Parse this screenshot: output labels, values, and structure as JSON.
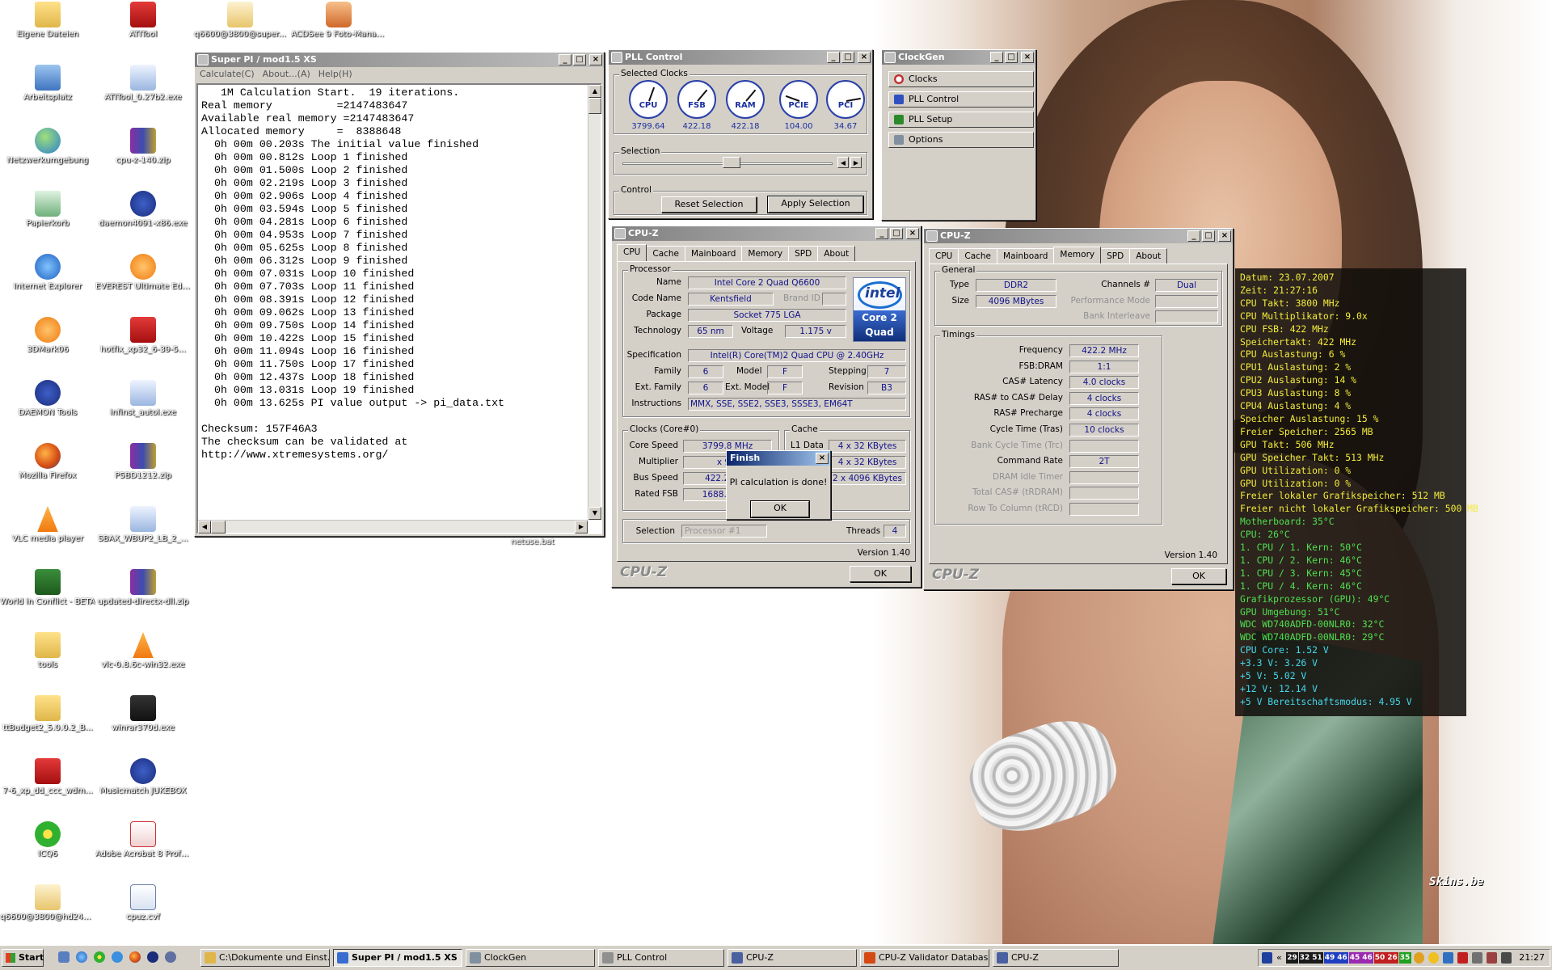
{
  "desktop": {
    "watermark": "Skins.be",
    "icons": [
      {
        "label": "Eigene Dateien",
        "icon": "folder-icon"
      },
      {
        "label": "ATITool",
        "icon": "atitool-icon"
      },
      {
        "label": "q6600@3800@super...",
        "icon": "jpg-file-icon"
      },
      {
        "label": "ACDSee 9 Foto-Manager",
        "icon": "acdsee-icon"
      },
      {
        "label": "Arbeitsplatz",
        "icon": "computer-icon"
      },
      {
        "label": "ATITool_0.27b2.exe",
        "icon": "installer-icon"
      },
      {
        "label": "Netzwerkumgebung",
        "icon": "network-icon"
      },
      {
        "label": "cpu-z-140.zip",
        "icon": "rar-archive-icon"
      },
      {
        "label": "Papierkorb",
        "icon": "recycle-bin-icon"
      },
      {
        "label": "daemon4091-x86.exe",
        "icon": "daemon-tools-icon"
      },
      {
        "label": "Internet Explorer",
        "icon": "internet-explorer-icon"
      },
      {
        "label": "EVEREST Ultimate Edition",
        "icon": "everest-icon"
      },
      {
        "label": "3DMark06",
        "icon": "3dmark-icon"
      },
      {
        "label": "hotfix_xp32_6-39-5...",
        "icon": "ati-icon"
      },
      {
        "label": "DAEMON Tools",
        "icon": "daemon-tools-icon"
      },
      {
        "label": "infinst_autol.exe",
        "icon": "intel-installer-icon"
      },
      {
        "label": "Mozilla Firefox",
        "icon": "firefox-icon"
      },
      {
        "label": "P5BD1212.zip",
        "icon": "rar-archive-icon"
      },
      {
        "label": "VLC media player",
        "icon": "vlc-icon"
      },
      {
        "label": "SBAX_WBUP2_LB_2_...",
        "icon": "installer-icon"
      },
      {
        "label": "World in Conflict - BETA",
        "icon": "game-icon"
      },
      {
        "label": "updated-directx-dll.zip",
        "icon": "rar-archive-icon"
      },
      {
        "label": "tools",
        "icon": "folder-icon"
      },
      {
        "label": "vlc-0.8.6c-win32.exe",
        "icon": "vlc-icon"
      },
      {
        "label": "ttBudget2_5.0.0.2_B...",
        "icon": "folder-icon"
      },
      {
        "label": "winrar370d.exe",
        "icon": "winrar-icon"
      },
      {
        "label": "7-6_xp_dd_ccc_wdm...",
        "icon": "ati-icon"
      },
      {
        "label": "Musicmatch JUKEBOX",
        "icon": "musicmatch-icon"
      },
      {
        "label": "ICQ6",
        "icon": "icq-icon"
      },
      {
        "label": "Adobe Acrobat 8 Professional",
        "icon": "acrobat-icon"
      },
      {
        "label": "q6600@3800@hd2400...",
        "icon": "jpg-file-icon"
      },
      {
        "label": "cpuz.cvf",
        "icon": "config-file-icon"
      },
      {
        "label": "netuse.bat",
        "icon": "batch-file-icon"
      }
    ]
  },
  "superpi": {
    "title": "Super PI / mod1.5 XS",
    "menu": [
      "Calculate(C)",
      "About...(A)",
      "Help(H)"
    ],
    "lines": [
      "   1M Calculation Start.  19 iterations.",
      "Real memory          =2147483647",
      "Available real memory =2147483647",
      "Allocated memory     =  8388648",
      "  0h 00m 00.203s The initial value finished",
      "  0h 00m 00.812s Loop 1 finished",
      "  0h 00m 01.500s Loop 2 finished",
      "  0h 00m 02.219s Loop 3 finished",
      "  0h 00m 02.906s Loop 4 finished",
      "  0h 00m 03.594s Loop 5 finished",
      "  0h 00m 04.281s Loop 6 finished",
      "  0h 00m 04.953s Loop 7 finished",
      "  0h 00m 05.625s Loop 8 finished",
      "  0h 00m 06.312s Loop 9 finished",
      "  0h 00m 07.031s Loop 10 finished",
      "  0h 00m 07.703s Loop 11 finished",
      "  0h 00m 08.391s Loop 12 finished",
      "  0h 00m 09.062s Loop 13 finished",
      "  0h 00m 09.750s Loop 14 finished",
      "  0h 00m 10.422s Loop 15 finished",
      "  0h 00m 11.094s Loop 16 finished",
      "  0h 00m 11.750s Loop 17 finished",
      "  0h 00m 12.437s Loop 18 finished",
      "  0h 00m 13.031s Loop 19 finished",
      "  0h 00m 13.625s PI value output -> pi_data.txt",
      "",
      "Checksum: 157F46A3",
      "The checksum can be validated at",
      "http://www.xtremesystems.org/"
    ]
  },
  "pll": {
    "title": "PLL Control",
    "selected_clocks": "Selected Clocks",
    "dials": [
      {
        "label": "CPU",
        "value": "3799.64",
        "angle": 20
      },
      {
        "label": "FSB",
        "value": "422.18",
        "angle": 40
      },
      {
        "label": "RAM",
        "value": "422.18",
        "angle": 40
      },
      {
        "label": "PCIE",
        "value": "104.00",
        "angle": -70
      },
      {
        "label": "PCI",
        "value": "34.67",
        "angle": 80
      }
    ],
    "selection_group": "Selection",
    "control_group": "Control",
    "reset_btn": "Reset Selection",
    "apply_btn": "Apply Selection"
  },
  "clockgen": {
    "title": "ClockGen",
    "items": [
      "Clocks",
      "PLL Control",
      "PLL Setup",
      "Options"
    ]
  },
  "cpuz1": {
    "title": "CPU-Z",
    "tabs": [
      "CPU",
      "Cache",
      "Mainboard",
      "Memory",
      "SPD",
      "About"
    ],
    "processor_group": "Processor",
    "name_lbl": "Name",
    "name": "Intel Core 2 Quad Q6600",
    "codename_lbl": "Code Name",
    "codename": "Kentsfield",
    "brandid_lbl": "Brand ID",
    "package_lbl": "Package",
    "package": "Socket 775 LGA",
    "tech_lbl": "Technology",
    "tech": "65 nm",
    "voltage_lbl": "Voltage",
    "voltage": "1.175 v",
    "spec_lbl": "Specification",
    "spec": "Intel(R) Core(TM)2 Quad CPU      @ 2.40GHz",
    "family_lbl": "Family",
    "family": "6",
    "model_lbl": "Model",
    "model": "F",
    "stepping_lbl": "Stepping",
    "stepping": "7",
    "extfamily_lbl": "Ext. Family",
    "extfamily": "6",
    "extmodel_lbl": "Ext. Model",
    "extmodel": "F",
    "revision_lbl": "Revision",
    "revision": "B3",
    "instr_lbl": "Instructions",
    "instr": "MMX, SSE, SSE2, SSE3, SSSE3, EM64T",
    "clocks_group": "Clocks (Core#0)",
    "corespeed_lbl": "Core Speed",
    "corespeed": "3799.8 MHz",
    "mult_lbl": "Multiplier",
    "mult": "x 9.0",
    "bus_lbl": "Bus Speed",
    "bus": "422.2 MHz",
    "fsb_lbl": "Rated FSB",
    "fsb": "1688.8 MHz",
    "cache_group": "Cache",
    "l1d_lbl": "L1 Data",
    "l1d": "4 x 32 KBytes",
    "l1i": "4 x 32 KBytes",
    "l2": "2 x 4096 KBytes",
    "selection_lbl": "Selection",
    "selection": "Processor #1",
    "threads_lbl": "Threads",
    "threads": "4",
    "version": "Version 1.40",
    "brand": "CPU-Z",
    "ok": "OK",
    "logo_word": "intel",
    "logo_core": "Core 2",
    "logo_sub": "Quad"
  },
  "cpuz2": {
    "title": "CPU-Z",
    "tabs": [
      "CPU",
      "Cache",
      "Mainboard",
      "Memory",
      "SPD",
      "About"
    ],
    "general_group": "General",
    "type_lbl": "Type",
    "type": "DDR2",
    "channels_lbl": "Channels #",
    "channels": "Dual",
    "size_lbl": "Size",
    "size": "4096 MBytes",
    "perfmode_lbl": "Performance Mode",
    "bankint_lbl": "Bank Interleave",
    "timings_group": "Timings",
    "freq_lbl": "Frequency",
    "freq": "422.2 MHz",
    "fsbdram_lbl": "FSB:DRAM",
    "fsbdram": "1:1",
    "cas_lbl": "CAS# Latency",
    "cas": "4.0 clocks",
    "rcd_lbl": "RAS# to CAS# Delay",
    "rcd": "4 clocks",
    "rp_lbl": "RAS# Precharge",
    "rp": "4 clocks",
    "tras_lbl": "Cycle Time (Tras)",
    "tras": "10 clocks",
    "trc_lbl": "Bank Cycle Time (Trc)",
    "cr_lbl": "Command Rate",
    "cr": "2T",
    "idle_lbl": "DRAM Idle Timer",
    "trdram_lbl": "Total CAS# (tRDRAM)",
    "trcd_lbl": "Row To Column (tRCD)",
    "version": "Version 1.40",
    "brand": "CPU-Z",
    "ok": "OK"
  },
  "finish": {
    "title": "Finish",
    "message": "PI calculation is done!",
    "ok": "OK"
  },
  "overlay": {
    "colors": {
      "yellow": "#f2ec3a",
      "green": "#4fe04f",
      "cyan": "#44d8ee"
    },
    "lines": [
      {
        "text": "Datum: 23.07.2007",
        "color": "yellow"
      },
      {
        "text": "Zeit: 21:27:16",
        "color": "yellow"
      },
      {
        "text": "CPU Takt: 3800 MHz",
        "color": "yellow"
      },
      {
        "text": "CPU Multiplikator: 9.0x",
        "color": "yellow"
      },
      {
        "text": "CPU FSB: 422 MHz",
        "color": "yellow"
      },
      {
        "text": "Speichertakt: 422 MHz",
        "color": "yellow"
      },
      {
        "text": "CPU Auslastung: 6 %",
        "color": "yellow"
      },
      {
        "text": "CPU1 Auslastung: 2 %",
        "color": "yellow"
      },
      {
        "text": "CPU2 Auslastung: 14 %",
        "color": "yellow"
      },
      {
        "text": "CPU3 Auslastung: 8 %",
        "color": "yellow"
      },
      {
        "text": "CPU4 Auslastung: 4 %",
        "color": "yellow"
      },
      {
        "text": "Speicher Auslastung: 15 %",
        "color": "yellow"
      },
      {
        "text": "Freier Speicher: 2565 MB",
        "color": "yellow"
      },
      {
        "text": "GPU Takt: 506 MHz",
        "color": "yellow"
      },
      {
        "text": "GPU Speicher Takt: 513 MHz",
        "color": "yellow"
      },
      {
        "text": "GPU Utilization: 0 %",
        "color": "yellow"
      },
      {
        "text": "GPU Utilization: 0 %",
        "color": "yellow"
      },
      {
        "text": "Freier lokaler Grafikspeicher: 512 MB",
        "color": "yellow"
      },
      {
        "text": "Freier nicht lokaler Grafikspeicher: 500 MB",
        "color": "yellow"
      },
      {
        "text": "Motherboard: 35°C",
        "color": "green"
      },
      {
        "text": "CPU: 26°C",
        "color": "green"
      },
      {
        "text": "1. CPU / 1. Kern: 50°C",
        "color": "green"
      },
      {
        "text": "1. CPU / 2. Kern: 46°C",
        "color": "green"
      },
      {
        "text": "1. CPU / 3. Kern: 45°C",
        "color": "green"
      },
      {
        "text": "1. CPU / 4. Kern: 46°C",
        "color": "green"
      },
      {
        "text": "Grafikprozessor (GPU): 49°C",
        "color": "green"
      },
      {
        "text": "GPU Umgebung: 51°C",
        "color": "green"
      },
      {
        "text": "WDC WD740ADFD-00NLR0: 32°C",
        "color": "green"
      },
      {
        "text": "WDC WD740ADFD-00NLR0: 29°C",
        "color": "green"
      },
      {
        "text": "CPU Core: 1.52 V",
        "color": "cyan"
      },
      {
        "text": " +3.3 V: 3.26 V",
        "color": "cyan"
      },
      {
        "text": " +5 V: 5.02 V",
        "color": "cyan"
      },
      {
        "text": " +12 V: 12.14 V",
        "color": "cyan"
      },
      {
        "text": " +5 V Bereitschaftsmodus: 4.95 V",
        "color": "cyan"
      }
    ]
  },
  "taskbar": {
    "start": "Start",
    "tasks": [
      {
        "label": "C:\\Dokumente und Einst...",
        "icon": "folder-icon",
        "active": false
      },
      {
        "label": "Super PI / mod1.5 XS",
        "icon": "superpi-icon",
        "active": true
      },
      {
        "label": "ClockGen",
        "icon": "clockgen-icon",
        "active": false
      },
      {
        "label": "PLL Control",
        "icon": "window-icon",
        "active": false
      },
      {
        "label": "CPU-Z",
        "icon": "cpuz-icon",
        "active": false
      },
      {
        "label": "CPU-Z Validator Databas...",
        "icon": "firefox-icon",
        "active": false
      },
      {
        "label": "CPU-Z",
        "icon": "cpuz-icon",
        "active": false
      }
    ],
    "tray_numbers": [
      {
        "n": "29",
        "c": "#1a1a1a"
      },
      {
        "n": "32",
        "c": "#1a1a1a"
      },
      {
        "n": "51",
        "c": "#1a1a1a"
      },
      {
        "n": "49",
        "c": "#2040c0"
      },
      {
        "n": "46",
        "c": "#2040c0"
      },
      {
        "n": "45",
        "c": "#9a2ab0"
      },
      {
        "n": "46",
        "c": "#9a2ab0"
      },
      {
        "n": "50",
        "c": "#c02020"
      },
      {
        "n": "26",
        "c": "#c02020"
      },
      {
        "n": "35",
        "c": "#20a020"
      }
    ],
    "clock": "21:27"
  }
}
